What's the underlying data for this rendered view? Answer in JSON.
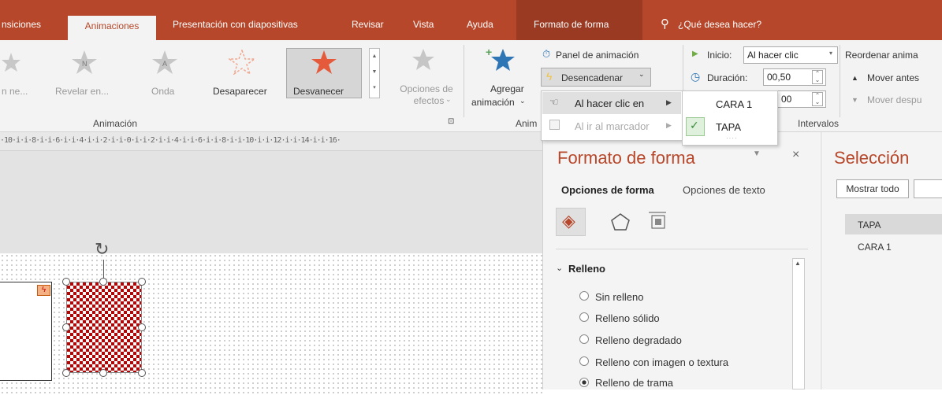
{
  "tabs": {
    "t0": "nsiciones",
    "t1": "Animaciones",
    "t2": "Presentación con diapositivas",
    "t3": "Revisar",
    "t4": "Vista",
    "t5": "Ayuda",
    "t6": "Formato de forma",
    "tell": "¿Qué desea hacer?"
  },
  "ribbon": {
    "anim_items": [
      "n ne...",
      "Revelar en...",
      "Onda",
      "Desaparecer",
      "Desvanecer"
    ],
    "opciones1": "Opciones de",
    "opciones2": "efectos",
    "agregar1": "Agregar",
    "agregar2": "animación",
    "group_animacion": "Animación",
    "group_anim": "Anim",
    "group_intervalos": "Intervalos",
    "panel": "Panel de animación",
    "desencadenar": "Desencadenar",
    "inicio_label": "Inicio:",
    "inicio_value": "Al hacer clic",
    "duracion_label": "Duración:",
    "duracion_value": "00,50",
    "retraso_value": "00",
    "reordenar": "Reordenar anima",
    "mover_antes": "Mover antes",
    "mover_despues": "Mover despu"
  },
  "menu": {
    "item1": "Al hacer clic en",
    "item2": "Al ir al marcador",
    "sub1": "CARA 1",
    "sub2": "TAPA"
  },
  "ruler": "·10·i·i·8·i·i·6·i·i·4·i·i·2·i·i·0·i·i·2·i·i·4·i·i·6·i·i·8·i·i·10·i·i·12·i·i·14·i·i·16·",
  "format": {
    "title": "Formato de forma",
    "tab1": "Opciones de forma",
    "tab2": "Opciones de texto",
    "section": "Relleno",
    "options": [
      "Sin relleno",
      "Relleno sólido",
      "Relleno degradado",
      "Relleno con imagen o textura",
      "Relleno de trama"
    ]
  },
  "selection": {
    "title": "Selección",
    "show_all": "Mostrar todo",
    "items": [
      "TAPA",
      "CARA 1"
    ]
  },
  "colors": {
    "accent": "#b7472a",
    "accent_dark": "#9a3a22",
    "star": "#e65a3c"
  }
}
